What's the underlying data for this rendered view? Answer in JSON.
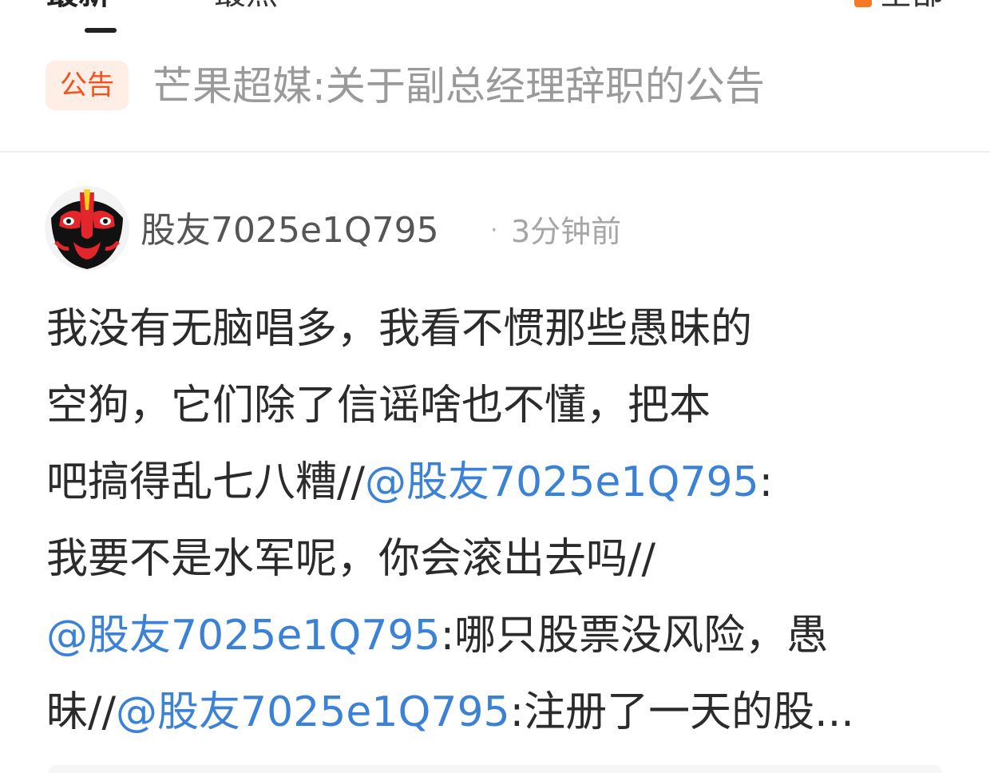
{
  "tabs": {
    "latest": "最新",
    "hot": "最热",
    "filter": "全部"
  },
  "notice": {
    "badge": "公告",
    "text": "芒果超媒:关于副总经理辞职的公告"
  },
  "post": {
    "author": "股友7025e1Q795",
    "separator": "·",
    "time": "3分钟前",
    "lines": [
      {
        "text1": "我没有无脑唱多，我看不惯那些愚昧的"
      },
      {
        "text1": "空狗，它们除了信谣啥也不懂，把本"
      },
      {
        "text1": "吧搞得乱七八糟//",
        "mention": "@股友7025e1Q795",
        "text2": ":"
      },
      {
        "text1": "我要不是水军呢，你会滚出去吗//"
      },
      {
        "mention": "@股友7025e1Q795",
        "text2": ":哪只股票没风险，愚"
      },
      {
        "text1": "昧//",
        "mention": "@股友7025e1Q795",
        "text2": ":注册了一天的股..."
      }
    ]
  },
  "colors": {
    "accent": "#f2521d",
    "mention": "#3b82d6",
    "muted": "#9a9a9a"
  }
}
